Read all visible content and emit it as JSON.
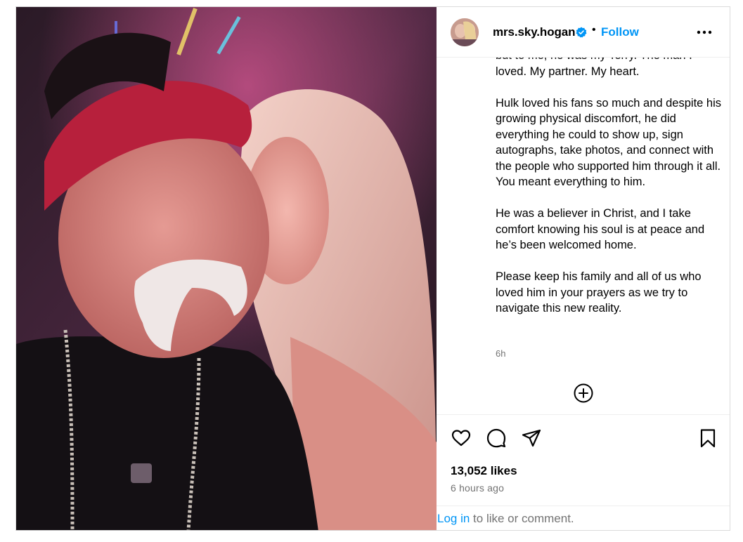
{
  "post": {
    "username": "mrs.sky.hogan",
    "separator": "•",
    "follow_label": "Follow",
    "more_icon": "more-options-icon",
    "caption_top_partial": "but to me, he was my Terry. The man I loved. My partner. My heart.",
    "caption_paragraphs": [
      "Hulk loved his fans so much and despite his growing physical discomfort, he did everything he could to show up, sign autographs, take photos, and connect with the people who supported him through it all. You meant everything to him.",
      "He was a believer in Christ, and I take comfort knowing his soul is at peace and he’s been welcomed home.",
      "Please keep his family and all of us who loved him in your prayers as we try to navigate this new reality."
    ],
    "timestamp_short": "6h",
    "likes": "13,052 likes",
    "time_ago": "6 hours ago",
    "login_link": "Log in",
    "login_rest": " to like or comment."
  },
  "icons": {
    "like": "heart-icon",
    "comment": "comment-icon",
    "share": "share-icon",
    "save": "bookmark-icon",
    "add_comment": "add-circle-icon",
    "verified": "verified-badge-icon"
  },
  "colors": {
    "link_blue": "#0095f6",
    "muted_text": "#737373",
    "divider": "#efefef",
    "verified_blue": "#0095f6"
  }
}
